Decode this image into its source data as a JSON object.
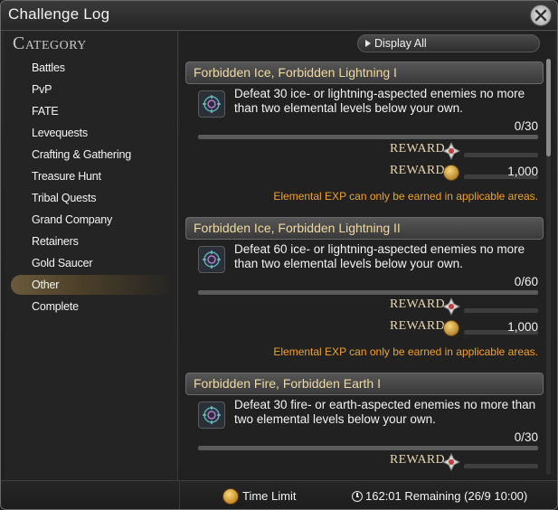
{
  "window": {
    "title": "Challenge Log"
  },
  "sidebar": {
    "heading": "Category",
    "items": [
      {
        "label": "Battles"
      },
      {
        "label": "PvP"
      },
      {
        "label": "FATE"
      },
      {
        "label": "Levequests"
      },
      {
        "label": "Crafting & Gathering"
      },
      {
        "label": "Treasure Hunt"
      },
      {
        "label": "Tribal Quests"
      },
      {
        "label": "Grand Company"
      },
      {
        "label": "Retainers"
      },
      {
        "label": "Gold Saucer"
      },
      {
        "label": "Other"
      },
      {
        "label": "Complete"
      }
    ],
    "selected": "Other"
  },
  "main": {
    "display_all_label": "Display All",
    "entries": [
      {
        "title": "Forbidden Ice, Forbidden Lightning I",
        "description": "Defeat 30 ice- or lightning-aspected enemies no more than two elemental levels below your own.",
        "progress": "0/30",
        "progress_fraction": 0,
        "reward_label_1": "REWARD",
        "reward_label_2": "REWARD",
        "reward_gil": "1,000",
        "note": "Elemental EXP can only be earned in applicable areas."
      },
      {
        "title": "Forbidden Ice, Forbidden Lightning II",
        "description": "Defeat 60 ice- or lightning-aspected enemies no more than two elemental levels below your own.",
        "progress": "0/60",
        "progress_fraction": 0,
        "reward_label_1": "REWARD",
        "reward_label_2": "REWARD",
        "reward_gil": "1,000",
        "note": "Elemental EXP can only be earned in applicable areas."
      },
      {
        "title": "Forbidden Fire, Forbidden Earth I",
        "description": "Defeat 30 fire- or earth-aspected enemies no more than two elemental levels below your own.",
        "progress": "0/30",
        "progress_fraction": 0,
        "reward_label_1": "REWARD"
      }
    ]
  },
  "footer": {
    "time_limit_label": "Time Limit",
    "remaining": "162:01 Remaining (26/9 10:00)"
  },
  "colors": {
    "accent_gold": "#f0d9a0",
    "note_orange": "#f0a030",
    "selected_bg": "#6a5a3a"
  },
  "icons": {
    "close": "close-icon",
    "challenge": "challenge-emblem-icon",
    "reward_item": "reward-item-icon",
    "gil": "gil-coin-icon",
    "time_limit": "time-limit-icon",
    "clock": "clock-icon"
  }
}
